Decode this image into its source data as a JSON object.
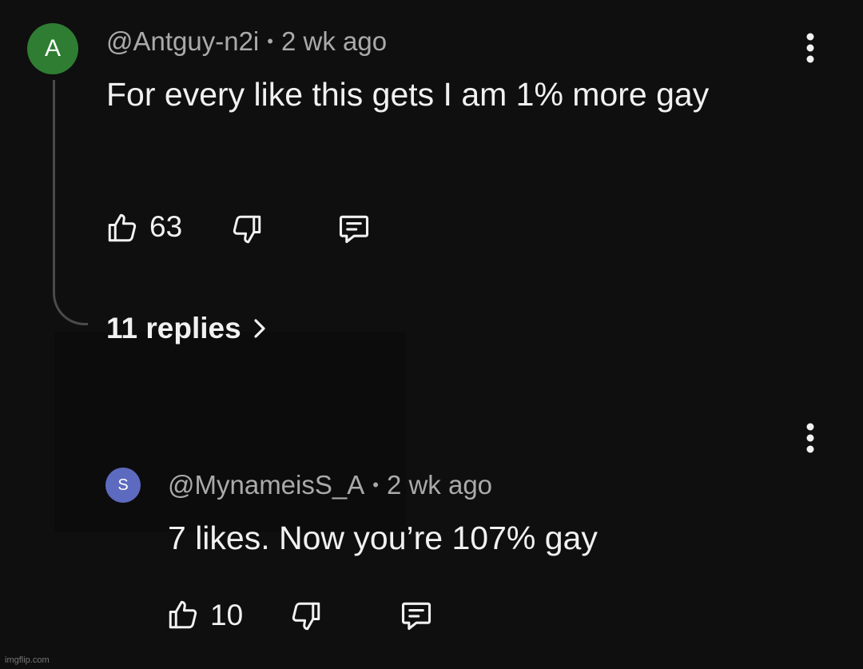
{
  "comment": {
    "avatar_letter": "A",
    "avatar_color": "#2e7d32",
    "author": "@Antguy-n2i",
    "separator": "•",
    "time": "2 wk ago",
    "text": "For every like this gets I am 1% more gay",
    "like_count": "63",
    "icons": [
      "thumbs-up-icon",
      "thumbs-down-icon",
      "reply-icon",
      "more-vert-icon"
    ],
    "replies_label": "11 replies",
    "replies_chevron": ">"
  },
  "reply": {
    "avatar_letter": "S",
    "avatar_color": "#5c6bc0",
    "author": "@MynameisS_A",
    "separator": "•",
    "time": "2 wk ago",
    "text": "7 likes. Now you’re 107% gay",
    "like_count": "10",
    "icons": [
      "thumbs-up-icon",
      "thumbs-down-icon",
      "reply-icon",
      "more-vert-icon"
    ]
  },
  "watermark": "imgflip.com"
}
